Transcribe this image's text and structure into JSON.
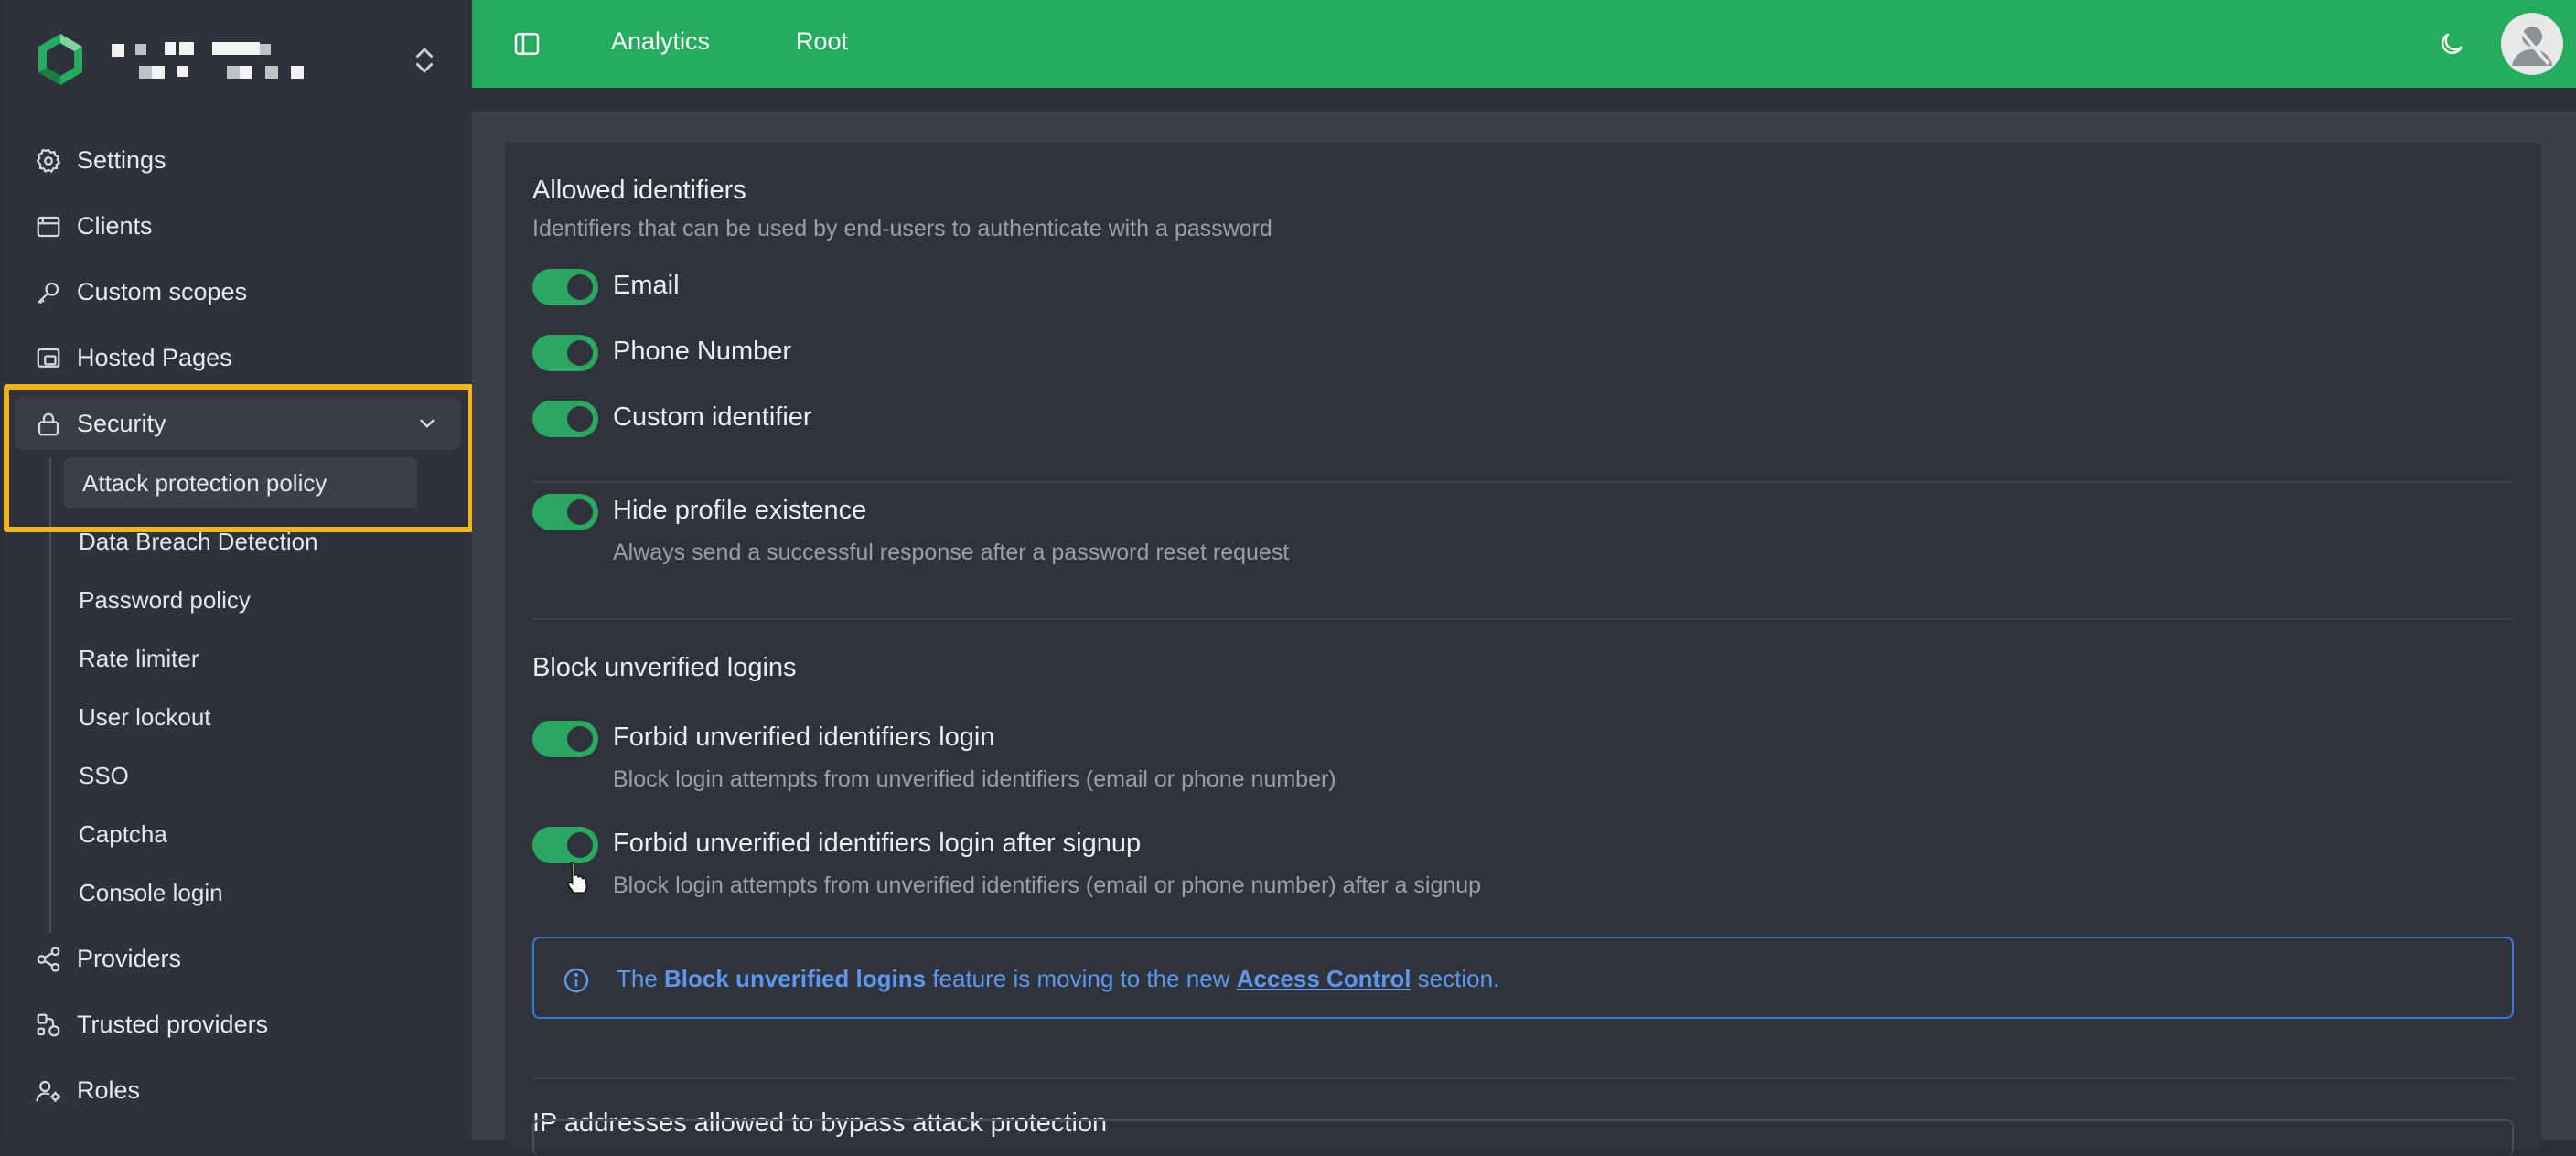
{
  "topbar": {
    "links": [
      "Analytics",
      "Root"
    ]
  },
  "sidebar": {
    "items": [
      {
        "label": "Settings",
        "icon": "gear-icon"
      },
      {
        "label": "Clients",
        "icon": "window-icon"
      },
      {
        "label": "Custom scopes",
        "icon": "key-icon"
      },
      {
        "label": "Hosted Pages",
        "icon": "pages-icon"
      },
      {
        "label": "Security",
        "icon": "lock-icon"
      }
    ],
    "security_children": [
      "Attack protection policy",
      "Data Breach Detection",
      "Password policy",
      "Rate limiter",
      "User lockout",
      "SSO",
      "Captcha",
      "Console login"
    ],
    "bottom_items": [
      {
        "label": "Providers",
        "icon": "share-icon"
      },
      {
        "label": "Trusted providers",
        "icon": "nodes-icon"
      },
      {
        "label": "Roles",
        "icon": "user-gear-icon"
      }
    ]
  },
  "main": {
    "allowed_identifiers": {
      "title": "Allowed identifiers",
      "description": "Identifiers that can be used by end-users to authenticate with a password",
      "options": [
        "Email",
        "Phone Number",
        "Custom identifier"
      ]
    },
    "hide_profile": {
      "label": "Hide profile existence",
      "description": "Always send a successful response after a password reset request"
    },
    "block_unverified": {
      "title": "Block unverified logins",
      "options": [
        {
          "label": "Forbid unverified identifiers login",
          "description": "Block login attempts from unverified identifiers (email or phone number)"
        },
        {
          "label": "Forbid unverified identifiers login after signup",
          "description": "Block login attempts from unverified identifiers (email or phone number) after a signup"
        }
      ]
    },
    "info": {
      "prefix": "The ",
      "feature": "Block unverified logins",
      "middle": " feature is moving to the new ",
      "link": "Access Control",
      "suffix": " section."
    },
    "ip_bypass": {
      "title": "IP addresses allowed to bypass attack protection"
    }
  },
  "colors": {
    "accent_green": "#27ab5f",
    "highlight": "#f4b321",
    "info_blue": "#3d78d8"
  }
}
